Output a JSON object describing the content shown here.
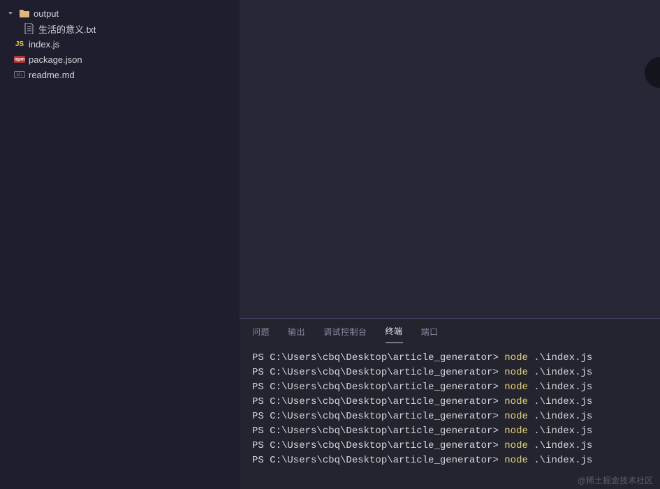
{
  "sidebar": {
    "folder": {
      "name": "output",
      "expanded": true
    },
    "items": [
      {
        "label": "生活的意义.txt",
        "iconType": "text-file"
      },
      {
        "label": "index.js",
        "iconType": "js"
      },
      {
        "label": "package.json",
        "iconType": "npm"
      },
      {
        "label": "readme.md",
        "iconType": "md"
      }
    ],
    "iconGlyphs": {
      "js": "JS",
      "npm": "npm",
      "md": "M↓"
    }
  },
  "panel": {
    "tabs": [
      {
        "label": "问题",
        "active": false
      },
      {
        "label": "输出",
        "active": false
      },
      {
        "label": "调试控制台",
        "active": false
      },
      {
        "label": "终端",
        "active": true
      },
      {
        "label": "端口",
        "active": false
      }
    ]
  },
  "terminal": {
    "prompt": "PS C:\\Users\\cbq\\Desktop\\article_generator>",
    "command_exe": "node",
    "command_arg": ".\\index.js",
    "lines": [
      0,
      1,
      2,
      3,
      4,
      5,
      6,
      7
    ]
  },
  "watermark": "@稀土掘金技术社区"
}
